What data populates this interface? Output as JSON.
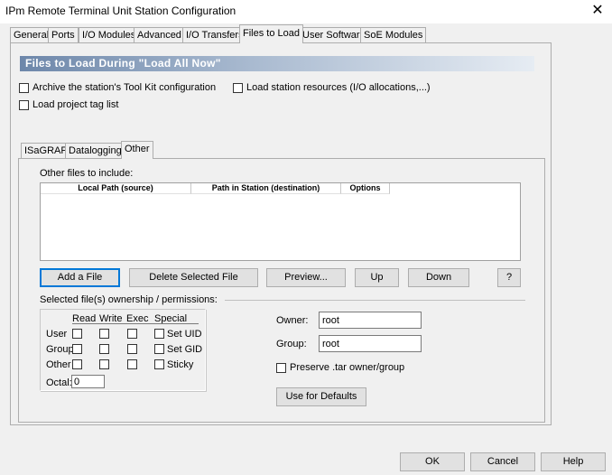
{
  "window": {
    "title": "IPm Remote Terminal Unit Station Configuration",
    "close_glyph": "✕"
  },
  "tabs": [
    {
      "label": "General"
    },
    {
      "label": "Ports"
    },
    {
      "label": "I/O Modules"
    },
    {
      "label": "Advanced"
    },
    {
      "label": "I/O Transfers"
    },
    {
      "label": "Files to Load",
      "active": true
    },
    {
      "label": "User Software"
    },
    {
      "label": "SoE Modules"
    }
  ],
  "section": {
    "banner": "Files to Load During \"Load All Now\""
  },
  "options": {
    "archive_toolkit": {
      "label": "Archive the station's Tool Kit configuration",
      "checked": false
    },
    "load_resources": {
      "label": "Load station resources (I/O allocations,...)",
      "checked": false
    },
    "load_tag_list": {
      "label": "Load project tag list",
      "checked": false
    }
  },
  "subtabs": [
    {
      "label": "ISaGRAF"
    },
    {
      "label": "Datalogging"
    },
    {
      "label": "Other",
      "active": true
    }
  ],
  "other": {
    "files_label": "Other files to include:",
    "columns": [
      "Local Path (source)",
      "Path in Station (destination)",
      "Options"
    ],
    "rows": [],
    "buttons": {
      "add": "Add a File",
      "delete": "Delete Selected File",
      "preview": "Preview...",
      "up": "Up",
      "down": "Down",
      "help": "?"
    },
    "permissions": {
      "label": "Selected file(s) ownership / permissions:",
      "headers": [
        "Read",
        "Write",
        "Exec",
        "Special"
      ],
      "rows": [
        {
          "label": "User",
          "special": "Set UID"
        },
        {
          "label": "Group",
          "special": "Set GID"
        },
        {
          "label": "Other",
          "special": "Sticky"
        }
      ],
      "octal_label": "Octal:",
      "octal_value": "0"
    },
    "owner_label": "Owner:",
    "owner_value": "root",
    "group_label": "Group:",
    "group_value": "root",
    "preserve_label": "Preserve .tar owner/group",
    "use_defaults": "Use for Defaults"
  },
  "footer": {
    "ok": "OK",
    "cancel": "Cancel",
    "help": "Help"
  },
  "colors": {
    "accent": "#0078d7",
    "banner_start": "#6d87aa"
  }
}
